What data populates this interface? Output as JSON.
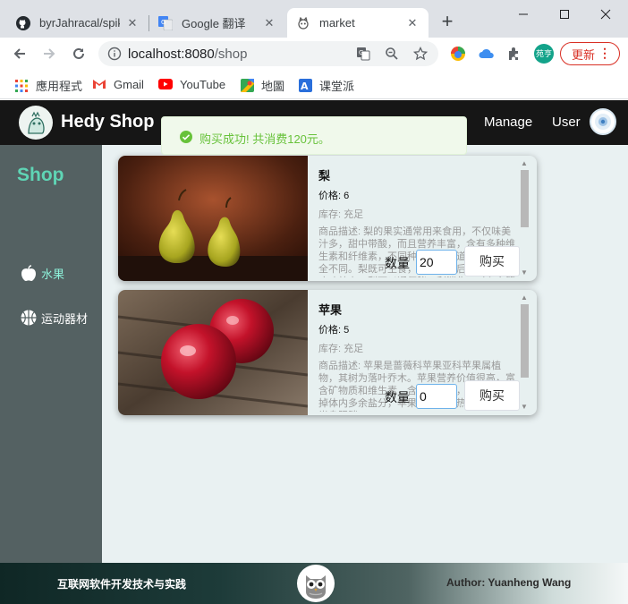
{
  "browser": {
    "tabs": [
      {
        "title": "byrJahracal/spik",
        "icon": "github-icon",
        "active": false
      },
      {
        "title": "Google 翻译",
        "icon": "google-translate-icon",
        "active": false
      },
      {
        "title": "market",
        "icon": "market-favicon",
        "active": true
      }
    ],
    "address": {
      "host": "localhost:8080",
      "path": "/shop"
    },
    "update_label": "更新",
    "profile_label": "苑亨",
    "bookmarks": [
      {
        "label": "應用程式",
        "icon": "apps-grid-icon"
      },
      {
        "label": "Gmail",
        "icon": "gmail-icon"
      },
      {
        "label": "YouTube",
        "icon": "youtube-icon"
      },
      {
        "label": "地圖",
        "icon": "maps-icon"
      },
      {
        "label": "课堂派",
        "icon": "ketangpai-icon"
      }
    ]
  },
  "header": {
    "brand": "Hedy Shop",
    "nav": [
      {
        "label": "Manage"
      },
      {
        "label": "User"
      }
    ]
  },
  "toast": {
    "message": "购买成功! 共消费120元。",
    "type": "success"
  },
  "sidebar": {
    "title": "Shop",
    "items": [
      {
        "label": "水果",
        "icon": "apple-icon",
        "active": true
      },
      {
        "label": "运动器材",
        "icon": "basketball-icon",
        "active": false
      }
    ]
  },
  "products": [
    {
      "name": "梨",
      "price": "价格: 6",
      "stock": "库存: 充足",
      "description": "商品描述: 梨的果实通常用来食用，不仅味美汁多，甜中带酸，而且营养丰富，含有多种维生素和纤维素，不同种类的梨味道和质感都完全不同。梨既可生食，也可蒸煮后食用。在医疗功效上，梨可以通便秘，利消化，对心血管也有好处。",
      "quantity_label": "数量",
      "quantity": "20",
      "buy_label": "购买"
    },
    {
      "name": "苹果",
      "price": "价格: 5",
      "stock": "库存: 充足",
      "description": "商品描述: 苹果是蔷薇科苹果亚科苹果属植物，其树为落叶乔木。苹果营养价值很高，富含矿物质和维生素，含钙量丰富，有助于代谢掉体内多余盐分，苹果酸可代谢热量，防止下半身肥胖。",
      "quantity_label": "数量",
      "quantity": "0",
      "buy_label": "购买"
    }
  ],
  "footer": {
    "left_text": "互联网软件开发技术与实践",
    "right_text": "Author: Yuanheng Wang"
  },
  "colors": {
    "sidebar_bg": "#546162",
    "accent": "#5fd5b5",
    "success": "#67c23a",
    "header_bg": "#161616"
  }
}
